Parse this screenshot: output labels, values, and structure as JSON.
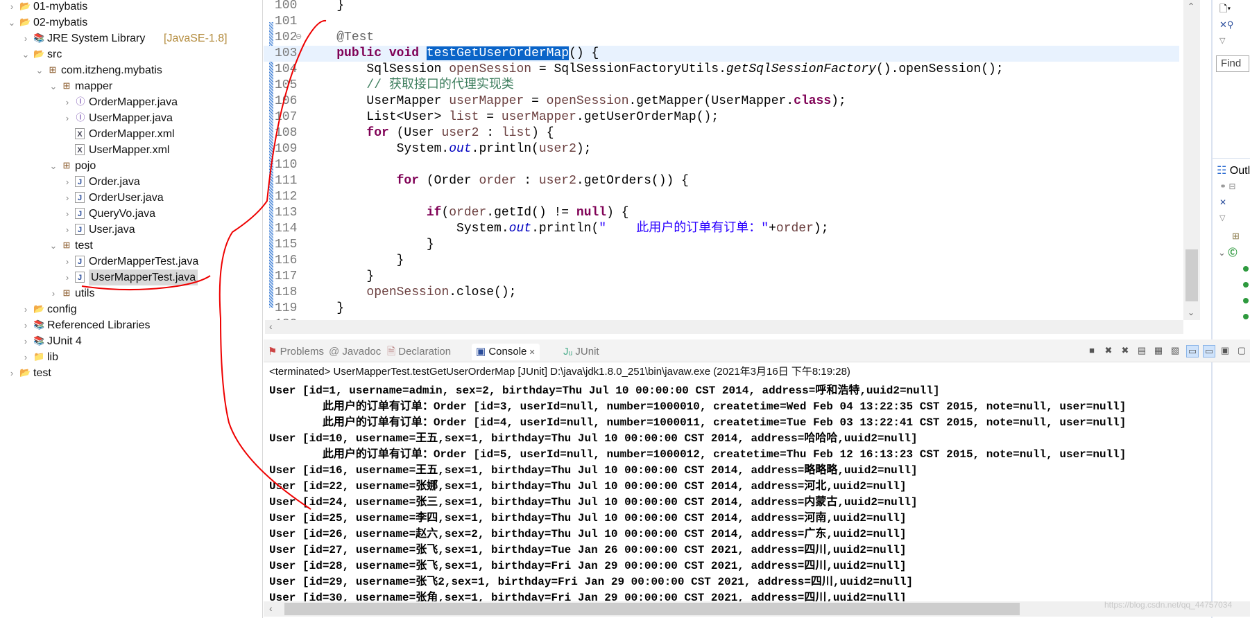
{
  "explorer": {
    "items": [
      {
        "label": "01-mybatis",
        "level": 0,
        "expanded": false,
        "icon": "java-project-warning-icon"
      },
      {
        "label": "02-mybatis",
        "level": 0,
        "expanded": true,
        "icon": "java-project-warning-icon"
      },
      {
        "label": "JRE System Library",
        "suffix": "[JavaSE-1.8]",
        "level": 1,
        "expanded": false,
        "icon": "library-icon"
      },
      {
        "label": "src",
        "level": 1,
        "expanded": true,
        "icon": "source-folder-icon"
      },
      {
        "label": "com.itzheng.mybatis",
        "level": 2,
        "expanded": true,
        "icon": "package-warning-icon"
      },
      {
        "label": "mapper",
        "level": 3,
        "expanded": true,
        "icon": "package-icon"
      },
      {
        "label": "OrderMapper.java",
        "level": 4,
        "expanded": false,
        "icon": "java-interface-icon"
      },
      {
        "label": "UserMapper.java",
        "level": 4,
        "expanded": false,
        "icon": "java-interface-icon"
      },
      {
        "label": "OrderMapper.xml",
        "level": 4,
        "icon": "xml-file-icon"
      },
      {
        "label": "UserMapper.xml",
        "level": 4,
        "icon": "xml-file-icon"
      },
      {
        "label": "pojo",
        "level": 3,
        "expanded": true,
        "icon": "package-icon"
      },
      {
        "label": "Order.java",
        "level": 4,
        "expanded": false,
        "icon": "java-file-icon"
      },
      {
        "label": "OrderUser.java",
        "level": 4,
        "expanded": false,
        "icon": "java-file-icon"
      },
      {
        "label": "QueryVo.java",
        "level": 4,
        "expanded": false,
        "icon": "java-file-icon"
      },
      {
        "label": "User.java",
        "level": 4,
        "expanded": false,
        "icon": "java-file-icon"
      },
      {
        "label": "test",
        "level": 3,
        "expanded": true,
        "icon": "package-warning-icon"
      },
      {
        "label": "OrderMapperTest.java",
        "level": 4,
        "expanded": false,
        "icon": "java-file-warning-icon"
      },
      {
        "label": "UserMapperTest.java",
        "level": 4,
        "expanded": false,
        "icon": "java-file-icon",
        "selected": true
      },
      {
        "label": "utils",
        "level": 3,
        "expanded": false,
        "icon": "package-icon"
      },
      {
        "label": "config",
        "level": 1,
        "expanded": false,
        "icon": "source-folder-icon"
      },
      {
        "label": "Referenced Libraries",
        "level": 1,
        "expanded": false,
        "icon": "library-icon"
      },
      {
        "label": "JUnit 4",
        "level": 1,
        "expanded": false,
        "icon": "library-icon"
      },
      {
        "label": "lib",
        "level": 1,
        "expanded": false,
        "icon": "folder-icon"
      },
      {
        "label": "test",
        "level": 0,
        "expanded": false,
        "icon": "java-project-icon"
      }
    ]
  },
  "editor": {
    "current_line": "103",
    "lines": [
      {
        "n": "100",
        "tokens": [
          {
            "t": "    }",
            "k": ""
          }
        ]
      },
      {
        "n": "101",
        "tokens": []
      },
      {
        "n": "102",
        "tokens": [
          {
            "t": "    ",
            "k": ""
          },
          {
            "t": "@Test",
            "k": "ann"
          }
        ],
        "fold": true
      },
      {
        "n": "103",
        "tokens": [
          {
            "t": "    ",
            "k": ""
          },
          {
            "t": "public",
            "k": "kw"
          },
          {
            "t": " ",
            "k": ""
          },
          {
            "t": "void",
            "k": "kw"
          },
          {
            "t": " ",
            "k": ""
          },
          {
            "t": "testGetUserOrderMap",
            "k": "hl"
          },
          {
            "t": "() {",
            "k": ""
          }
        ]
      },
      {
        "n": "104",
        "tokens": [
          {
            "t": "        SqlSession ",
            "k": ""
          },
          {
            "t": "openSession",
            "k": "loc"
          },
          {
            "t": " = SqlSessionFactoryUtils.",
            "k": ""
          },
          {
            "t": "getSqlSessionFactory",
            "k": "ital"
          },
          {
            "t": "().openSession();",
            "k": ""
          }
        ]
      },
      {
        "n": "105",
        "tokens": [
          {
            "t": "        ",
            "k": ""
          },
          {
            "t": "// 获取接口的代理实现类",
            "k": "cmt"
          }
        ]
      },
      {
        "n": "106",
        "tokens": [
          {
            "t": "        UserMapper ",
            "k": ""
          },
          {
            "t": "userMapper",
            "k": "loc"
          },
          {
            "t": " = ",
            "k": ""
          },
          {
            "t": "openSession",
            "k": "loc"
          },
          {
            "t": ".getMapper(UserMapper.",
            "k": ""
          },
          {
            "t": "class",
            "k": "kw"
          },
          {
            "t": ");",
            "k": ""
          }
        ]
      },
      {
        "n": "107",
        "tokens": [
          {
            "t": "        List<User> ",
            "k": ""
          },
          {
            "t": "list",
            "k": "loc"
          },
          {
            "t": " = ",
            "k": ""
          },
          {
            "t": "userMapper",
            "k": "loc"
          },
          {
            "t": ".getUserOrderMap();",
            "k": ""
          }
        ]
      },
      {
        "n": "108",
        "tokens": [
          {
            "t": "        ",
            "k": ""
          },
          {
            "t": "for",
            "k": "kw"
          },
          {
            "t": " (User ",
            "k": ""
          },
          {
            "t": "user2",
            "k": "loc"
          },
          {
            "t": " : ",
            "k": ""
          },
          {
            "t": "list",
            "k": "loc"
          },
          {
            "t": ") {",
            "k": ""
          }
        ]
      },
      {
        "n": "109",
        "tokens": [
          {
            "t": "            System.",
            "k": ""
          },
          {
            "t": "out",
            "k": "fld"
          },
          {
            "t": ".println(",
            "k": ""
          },
          {
            "t": "user2",
            "k": "loc"
          },
          {
            "t": ");",
            "k": ""
          }
        ]
      },
      {
        "n": "110",
        "tokens": []
      },
      {
        "n": "111",
        "tokens": [
          {
            "t": "            ",
            "k": ""
          },
          {
            "t": "for",
            "k": "kw"
          },
          {
            "t": " (Order ",
            "k": ""
          },
          {
            "t": "order",
            "k": "loc"
          },
          {
            "t": " : ",
            "k": ""
          },
          {
            "t": "user2",
            "k": "loc"
          },
          {
            "t": ".getOrders()) {",
            "k": ""
          }
        ]
      },
      {
        "n": "112",
        "tokens": []
      },
      {
        "n": "113",
        "tokens": [
          {
            "t": "                ",
            "k": ""
          },
          {
            "t": "if",
            "k": "kw"
          },
          {
            "t": "(",
            "k": ""
          },
          {
            "t": "order",
            "k": "loc"
          },
          {
            "t": ".getId() != ",
            "k": ""
          },
          {
            "t": "null",
            "k": "kw"
          },
          {
            "t": ") {",
            "k": ""
          }
        ]
      },
      {
        "n": "114",
        "tokens": [
          {
            "t": "                    System.",
            "k": ""
          },
          {
            "t": "out",
            "k": "fld"
          },
          {
            "t": ".println(",
            "k": ""
          },
          {
            "t": "\"    此用户的订单有订单：\"",
            "k": "str"
          },
          {
            "t": "+",
            "k": ""
          },
          {
            "t": "order",
            "k": "loc"
          },
          {
            "t": ");",
            "k": ""
          }
        ]
      },
      {
        "n": "115",
        "tokens": [
          {
            "t": "                }",
            "k": ""
          }
        ]
      },
      {
        "n": "116",
        "tokens": [
          {
            "t": "            }",
            "k": ""
          }
        ]
      },
      {
        "n": "117",
        "tokens": [
          {
            "t": "        }",
            "k": ""
          }
        ]
      },
      {
        "n": "118",
        "tokens": [
          {
            "t": "        ",
            "k": ""
          },
          {
            "t": "openSession",
            "k": "loc"
          },
          {
            "t": ".close();",
            "k": ""
          }
        ]
      },
      {
        "n": "119",
        "tokens": [
          {
            "t": "    }",
            "k": ""
          }
        ]
      },
      {
        "n": "120",
        "tokens": []
      }
    ]
  },
  "right_panel": {
    "find_label": "Find",
    "outline_label": "Outli"
  },
  "console": {
    "tabs": [
      {
        "label": "Problems",
        "icon": "problems-icon"
      },
      {
        "label": "Javadoc",
        "icon": "at-icon"
      },
      {
        "label": "Declaration",
        "icon": "declaration-icon"
      },
      {
        "label": "Console",
        "icon": "console-icon",
        "active": true,
        "closable": true
      },
      {
        "label": "JUnit",
        "icon": "junit-icon"
      }
    ],
    "header": "<terminated> UserMapperTest.testGetUserOrderMap [JUnit] D:\\java\\jdk1.8.0_251\\bin\\javaw.exe (2021年3月16日 下午8:19:28)",
    "lines": [
      "User [id=1, username=admin, sex=2, birthday=Thu Jul 10 00:00:00 CST 2014, address=呼和浩特,uuid2=null]",
      "        此用户的订单有订单：Order [id=3, userId=null, number=1000010, createtime=Wed Feb 04 13:22:35 CST 2015, note=null, user=null]",
      "        此用户的订单有订单：Order [id=4, userId=null, number=1000011, createtime=Tue Feb 03 13:22:41 CST 2015, note=null, user=null]",
      "User [id=10, username=王五,sex=1, birthday=Thu Jul 10 00:00:00 CST 2014, address=哈哈哈,uuid2=null]",
      "        此用户的订单有订单：Order [id=5, userId=null, number=1000012, createtime=Thu Feb 12 16:13:23 CST 2015, note=null, user=null]",
      "User [id=16, username=王五,sex=1, birthday=Thu Jul 10 00:00:00 CST 2014, address=略略略,uuid2=null]",
      "User [id=22, username=张娜,sex=1, birthday=Thu Jul 10 00:00:00 CST 2014, address=河北,uuid2=null]",
      "User [id=24, username=张三,sex=1, birthday=Thu Jul 10 00:00:00 CST 2014, address=内蒙古,uuid2=null]",
      "User [id=25, username=李四,sex=1, birthday=Thu Jul 10 00:00:00 CST 2014, address=河南,uuid2=null]",
      "User [id=26, username=赵六,sex=2, birthday=Thu Jul 10 00:00:00 CST 2014, address=广东,uuid2=null]",
      "User [id=27, username=张飞,sex=1, birthday=Tue Jan 26 00:00:00 CST 2021, address=四川,uuid2=null]",
      "User [id=28, username=张飞,sex=1, birthday=Fri Jan 29 00:00:00 CST 2021, address=四川,uuid2=null]",
      "User [id=29, username=张飞2,sex=1, birthday=Fri Jan 29 00:00:00 CST 2021, address=四川,uuid2=null]",
      "User [id=30, username=张角,sex=1, birthday=Fri Jan 29 00:00:00 CST 2021, address=四川,uuid2=null]"
    ]
  },
  "watermark": "https://blog.csdn.net/qq_44757034",
  "colors": {
    "annotation_red": "#ee0000",
    "selection": "#0a64c8",
    "current_line": "#e8f2fe"
  }
}
